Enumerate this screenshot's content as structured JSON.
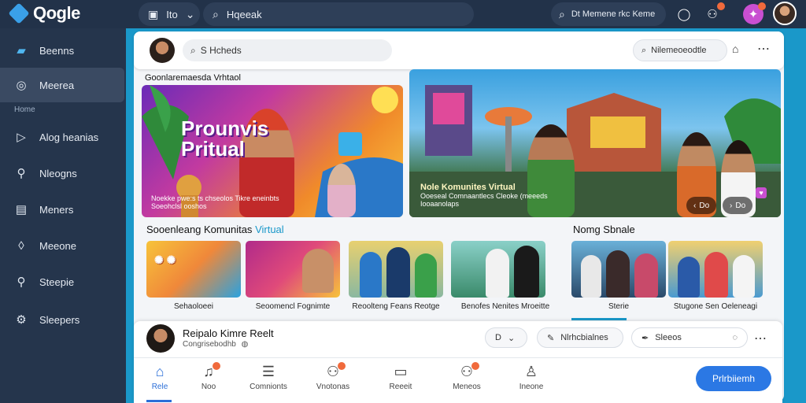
{
  "app": {
    "logo_text": "Qogle"
  },
  "topbar": {
    "left_pill_label": "Ito",
    "search_text": "Hqeeak",
    "right_pill_label": "Dt Memene rkc Keme"
  },
  "sidebar": {
    "section_label": "Home",
    "items": [
      {
        "label": "Beenns",
        "icon": "book-icon"
      },
      {
        "label": "Meerea",
        "icon": "circle-icon"
      },
      {
        "label": "Alog heanias",
        "icon": "play-icon"
      },
      {
        "label": "Nleogns",
        "icon": "search-icon"
      },
      {
        "label": "Meners",
        "icon": "box-icon"
      },
      {
        "label": "Meeone",
        "icon": "pin-icon"
      },
      {
        "label": "Steepie",
        "icon": "search-icon"
      },
      {
        "label": "Sleepers",
        "icon": "gear-icon"
      }
    ]
  },
  "subheader": {
    "search_text": "S Hcheds",
    "right_search_text": "Nilemeoeodtle"
  },
  "hero": {
    "left": {
      "label": "Goonlaremaesda Vrhtaol",
      "title": "Prounvis Pritual",
      "caption_line1": "Noekke pwe:s ts chseolos Tikre eneinbts",
      "caption_line2": "Soeohclsl ooshos"
    },
    "right": {
      "title": "Nole Komunites Virtual",
      "caption_line1": "Ooeseal Comnaantlecs Cleoke (meeeds",
      "caption_line2": "Iooaanolaps",
      "chip1": "Do",
      "chip2": "Do"
    }
  },
  "row": {
    "title_part1": "Sooenleang Komunitas",
    "title_part2": "Virtual",
    "right_title": "Nomg Sbnale",
    "thumbnails": [
      {
        "caption": "Sehaoloeei"
      },
      {
        "caption": "Seoomencl Fognimte"
      },
      {
        "caption": "Reoolteng Feans Reotge"
      },
      {
        "caption": "Benofes Nenites Mroeitte"
      },
      {
        "caption": "Sterie"
      },
      {
        "caption": "Stugone Sen Oeleneagi"
      }
    ]
  },
  "bottom": {
    "name": "Reipalo Kimre Reelt",
    "subtitle": "Congrisebodhb",
    "pill1": "D",
    "pill2": "Nlrhcbialnes",
    "pill3": "Sleeos",
    "nav": [
      {
        "label": "Rele"
      },
      {
        "label": "Noo"
      },
      {
        "label": "Comnionts"
      },
      {
        "label": "Vnotonas"
      },
      {
        "label": "Reeeit"
      },
      {
        "label": "Meneos"
      },
      {
        "label": "Ineone"
      }
    ],
    "publish_label": "Prlrbiiemh"
  }
}
